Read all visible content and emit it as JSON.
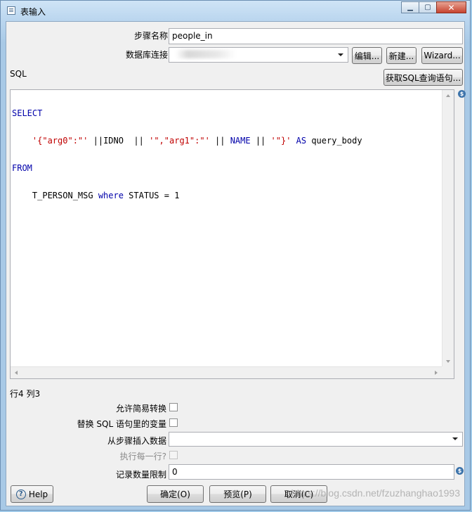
{
  "window": {
    "title": "表输入",
    "minimize_glyph": "▁",
    "maximize_glyph": "▢",
    "close_glyph": "✕"
  },
  "form": {
    "step_name_label": "步骤名称",
    "step_name_value": "people_in",
    "db_conn_label": "数据库连接",
    "db_conn_value": "",
    "edit_button": "编辑...",
    "new_button": "新建...",
    "wizard_button": "Wizard...",
    "sql_label": "SQL",
    "get_sql_button": "获取SQL查询语句..."
  },
  "sql": {
    "line1_kw": "SELECT",
    "line2_str1": "'{\"arg0\":\"'",
    "line2_mid1": " ||IDNO  || ",
    "line2_str2": "'\",\"arg1\":\"'",
    "line2_mid2": " || ",
    "line2_kw1": "NAME",
    "line2_mid3": " || ",
    "line2_str3": "'\"}'",
    "line2_mid4": " ",
    "line2_kw2": "AS",
    "line2_tail": " query_body",
    "line3_kw": "FROM",
    "line4_pre": "    T_PERSON_MSG ",
    "line4_kw": "where",
    "line4_tail": " STATUS = 1"
  },
  "status": {
    "cursor_position": "行4 列3"
  },
  "options": {
    "lazy_conversion_label": "允许简易转换",
    "replace_vars_label": "替换 SQL 语句里的变量",
    "insert_from_step_label": "从步骤插入数据",
    "insert_from_step_value": "",
    "execute_each_row_label": "执行每一行?",
    "row_limit_label": "记录数量限制",
    "row_limit_value": "0"
  },
  "footer": {
    "help_button": "Help",
    "ok_button": "确定(O)",
    "preview_button": "预览(P)",
    "cancel_button": "取消(C)",
    "watermark": "https://blog.csdn.net/fzuzhanghao1993"
  },
  "icons": {
    "variable_icon": "$",
    "help_icon": "?"
  }
}
